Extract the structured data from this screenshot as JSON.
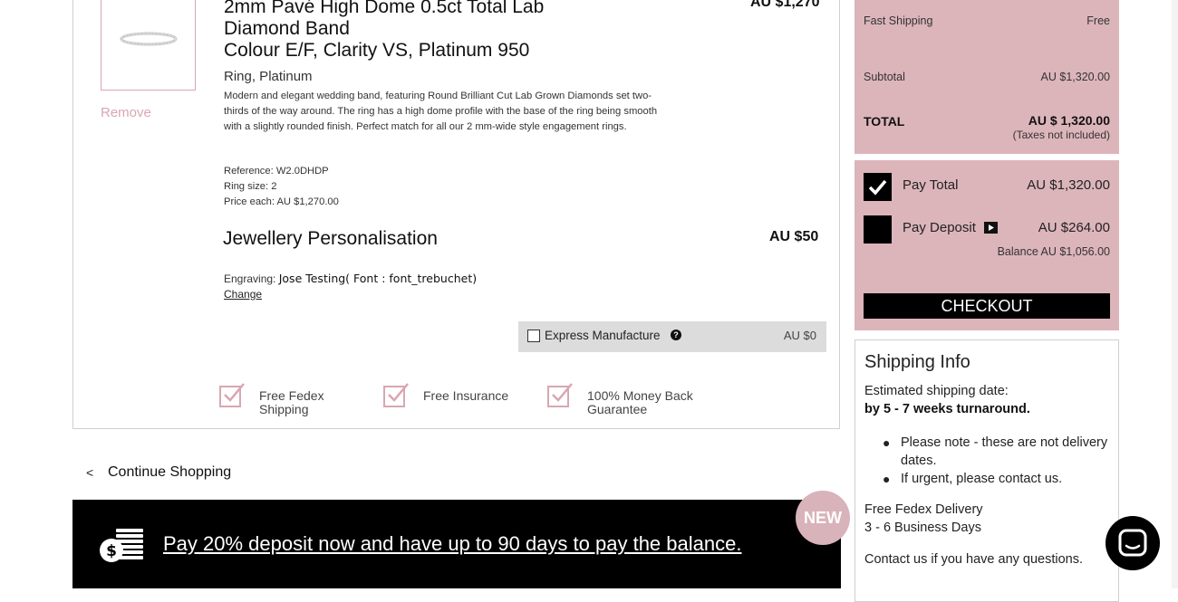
{
  "product": {
    "title_line1": "2mm Pavé High Dome 0.5ct Total Lab",
    "title_line2": "Diamond Band",
    "title_line3": "Colour E/F, Clarity VS, Platinum 950",
    "price": "AU $1,270",
    "remove_label": "Remove",
    "subtitle": "Ring, Platinum",
    "description": "Modern and elegant wedding band, featuring Round Brilliant Cut Lab Grown Diamonds set two-thirds of the way around. The ring has a high dome profile with the base of the ring being smooth with a slightly rounded finish. Perfect match for all our 2 mm-wide style engagement rings.",
    "reference": "Reference: W2.0DHDP",
    "ring_size": "Ring size: 2",
    "price_each": "Price each: AU $1,270.00"
  },
  "personalisation": {
    "title": "Jewellery Personalisation",
    "price": "AU $50",
    "engraving_label": "Engraving:",
    "engraving_value": "Jose Testing( Font : font_trebuchet)",
    "change_label": "Change"
  },
  "express": {
    "label": "Express Manufacture",
    "price": "AU $0",
    "help_icon": "?"
  },
  "benefits": [
    {
      "line1": "Free Fedex",
      "line2": "Shipping"
    },
    {
      "line1": "Free Insurance",
      "line2": ""
    },
    {
      "line1": "100% Money Back",
      "line2": "Guarantee"
    }
  ],
  "continue": {
    "arrow": "<",
    "label": "Continue Shopping"
  },
  "banner": {
    "text": "Pay 20% deposit now and have up to 90 days to pay the balance.",
    "badge": "NEW"
  },
  "summary": {
    "shipping_label": "Fast Shipping",
    "shipping_value": "Free",
    "subtotal_label": "Subtotal",
    "subtotal_value": "AU $1,320.00",
    "total_label": "TOTAL",
    "total_value": "AU $ 1,320.00",
    "taxes_note": "(Taxes not included)"
  },
  "payment": {
    "pay_total_label": "Pay Total",
    "pay_total_value": "AU $1,320.00",
    "pay_total_checked": true,
    "pay_deposit_label": "Pay Deposit",
    "pay_deposit_value": "AU $264.00",
    "pay_deposit_checked": false,
    "balance": "Balance AU $1,056.00",
    "checkout_label": "CHECKOUT"
  },
  "shipping_info": {
    "title": "Shipping Info",
    "estimated_label": "Estimated shipping date:",
    "estimated_value": "by 5 - 7 weeks turnaround.",
    "notes": [
      "Please note - these are not delivery dates.",
      "If urgent, please contact us."
    ],
    "fedex_line1": "Free Fedex Delivery",
    "fedex_line2": "3 - 6 Business Days",
    "contact": "Contact us if you have any questions."
  },
  "colors": {
    "accent_pink": "#dcb5bb",
    "banner_bg": "#000000"
  }
}
